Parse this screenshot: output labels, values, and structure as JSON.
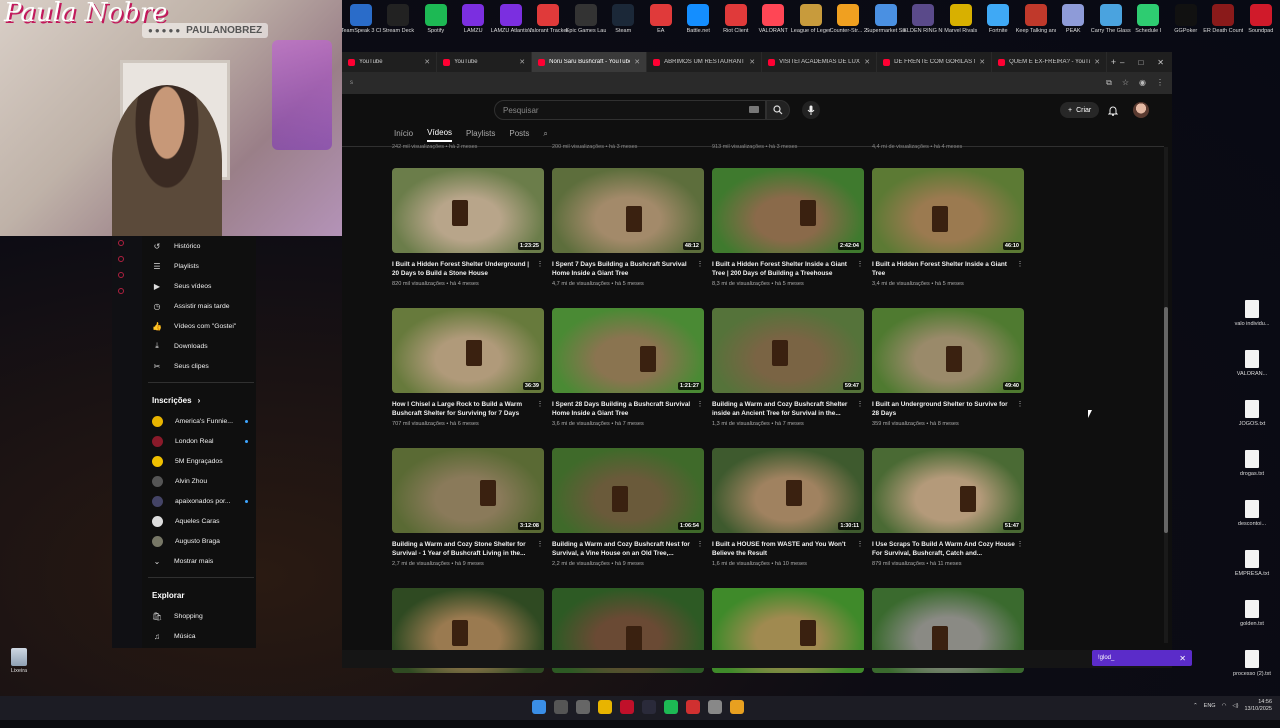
{
  "webcam": {
    "logo": "Paula Nobre",
    "handle": "PAULANOBREZ"
  },
  "desktop_top_icons": [
    {
      "label": "TeamSpeak 3 Client",
      "color": "#2a6cc9"
    },
    {
      "label": "Stream Deck",
      "color": "#222"
    },
    {
      "label": "Spotify",
      "color": "#1db954"
    },
    {
      "label": "LAMZU",
      "color": "#7b2fe0"
    },
    {
      "label": "LAMZU Atlantis P...",
      "color": "#7b2fe0"
    },
    {
      "label": "Valorant Tracker",
      "color": "#e03a3a"
    },
    {
      "label": "Epic Games Launcher",
      "color": "#333"
    },
    {
      "label": "Steam",
      "color": "#1b2838"
    },
    {
      "label": "EA",
      "color": "#e03a3a"
    },
    {
      "label": "Battle.net",
      "color": "#148eff"
    },
    {
      "label": "Riot Client",
      "color": "#e03a3a"
    },
    {
      "label": "VALORANT",
      "color": "#ff4655"
    },
    {
      "label": "League of Legends",
      "color": "#c89b3c"
    },
    {
      "label": "Counter-Str... 2",
      "color": "#f0a020"
    },
    {
      "label": "Supermarket Simulator",
      "color": "#4a90e2"
    },
    {
      "label": "ELDEN RING NIGHTREIGN",
      "color": "#5a4a8a"
    },
    {
      "label": "Marvel Rivals",
      "color": "#d8b000"
    },
    {
      "label": "Fortnite",
      "color": "#3fa9f5"
    },
    {
      "label": "Keep Talking and Nobo...",
      "color": "#c0392b"
    },
    {
      "label": "PEAK",
      "color": "#8e9bd8"
    },
    {
      "label": "Carry The Glass",
      "color": "#4aa3df"
    },
    {
      "label": "Schedule I",
      "color": "#2ecc71"
    },
    {
      "label": "GGPoker",
      "color": "#111"
    },
    {
      "label": "ER Death Counter",
      "color": "#8a1a1a"
    },
    {
      "label": "Soundpad",
      "color": "#d01a2a"
    }
  ],
  "desktop_right_icons": [
    "valo individu...",
    "VALORAN...",
    "JOGOS.txt",
    "drogas.txt",
    "descontoi...",
    "EMPRESA.txt",
    "golden.txt",
    "processo (2).txt"
  ],
  "recycle_bin": "Lixeira",
  "browser": {
    "tabs": [
      {
        "title": "YouTube",
        "active": false
      },
      {
        "title": "YouTube",
        "active": false
      },
      {
        "title": "Noru Saru Bushcraft - YouTube",
        "active": true
      },
      {
        "title": "ABRIMOS UM RESTAURANTE",
        "active": false
      },
      {
        "title": "VISITEI ACADEMIAS DE LUXO",
        "active": false
      },
      {
        "title": "DE FRENTE COM GORILAS N",
        "active": false
      },
      {
        "title": "QUEM É EX-FREIRA? - YouTu",
        "active": false
      }
    ],
    "url": "s"
  },
  "youtube": {
    "search_placeholder": "Pesquisar",
    "create_label": "Criar",
    "channel_tabs": [
      "Início",
      "Vídeos",
      "Playlists",
      "Posts"
    ],
    "active_tab": "Vídeos",
    "cut_meta": [
      "242 mil visualizações • há 2 meses",
      "200 mil visualizações • há 3 meses",
      "913 mil visualizações • há 3 meses",
      "4,4 mi de visualizações • há 4 meses"
    ],
    "videos": [
      {
        "title": "I Built a Hidden Forest Shelter Underground | 20 Days to Build a Stone House",
        "duration": "1:23:25",
        "meta": "820 mil visualizações • há 4 meses",
        "palette": [
          "#6b7d4a",
          "#b8a58a"
        ]
      },
      {
        "title": "I Spent 7 Days Building a Bushcraft Survival Home Inside a Giant Tree",
        "duration": "48:12",
        "meta": "4,7 mi de visualizações • há 5 meses",
        "palette": [
          "#5d6e3c",
          "#a38a6a"
        ]
      },
      {
        "title": "I Built a Hidden Forest Shelter Inside a Giant Tree | 200 Days of Building a Treehouse",
        "duration": "2:42:04",
        "meta": "8,3 mi de visualizações • há 5 meses",
        "palette": [
          "#3f7a2e",
          "#8a6a4a"
        ]
      },
      {
        "title": "I Built a Hidden Forest Shelter Inside a Giant Tree",
        "duration": "46:10",
        "meta": "3,4 mi de visualizações • há 5 meses",
        "palette": [
          "#5c7a34",
          "#9b7a50"
        ]
      },
      {
        "title": "How I Chisel a Large Rock to Build a Warm Bushcraft Shelter for Surviving for 7 Days",
        "duration": "36:39",
        "meta": "707 mil visualizações • há 6 meses",
        "palette": [
          "#677a3c",
          "#b09a7a"
        ]
      },
      {
        "title": "I Spent 28 Days Building a Bushcraft Survival Home Inside a Giant Tree",
        "duration": "1:21:27",
        "meta": "3,6 mi de visualizações • há 7 meses",
        "palette": [
          "#4a8a34",
          "#8a7450"
        ]
      },
      {
        "title": "Building a Warm and Cozy Bushcraft Shelter inside an Ancient Tree for Survival in the...",
        "duration": "59:47",
        "meta": "1,3 mi de visualizações • há 7 meses",
        "palette": [
          "#55733a",
          "#7a6444"
        ]
      },
      {
        "title": "I Built an Underground Shelter to Survive for 28 Days",
        "duration": "49:40",
        "meta": "359 mil visualizações • há 8 meses",
        "palette": [
          "#4f7a30",
          "#9a8a6a"
        ]
      },
      {
        "title": "Building a Warm and Cozy Stone Shelter for Survival - 1 Year of Bushcraft Living in the...",
        "duration": "3:12:08",
        "meta": "2,7 mi de visualizações • há 9 meses",
        "palette": [
          "#5a6a34",
          "#8a7a5a"
        ]
      },
      {
        "title": "Building a Warm and Cozy Bushcraft Nest for Survival, a Vine House on an Old Tree,...",
        "duration": "1:06:54",
        "meta": "2,2 mi de visualizações • há 9 meses",
        "palette": [
          "#3f6a2a",
          "#6a5a3a"
        ]
      },
      {
        "title": "I Built a HOUSE from WASTE and You Won't Believe the Result",
        "duration": "1:30:11",
        "meta": "1,6 mi de visualizações • há 10 meses",
        "palette": [
          "#3e5a2e",
          "#a08260"
        ]
      },
      {
        "title": "I Use Scraps To Build A Warm And Cozy House For Survival, Bushcraft, Catch and...",
        "duration": "51:47",
        "meta": "879 mil visualizações • há 11 meses",
        "palette": [
          "#4a6a34",
          "#b49a7a"
        ]
      },
      {
        "title": "",
        "duration": "",
        "meta": "",
        "palette": [
          "#2f4a22",
          "#9a7a50"
        ]
      },
      {
        "title": "",
        "duration": "",
        "meta": "",
        "palette": [
          "#2d5a24",
          "#6a4a34"
        ]
      },
      {
        "title": "",
        "duration": "",
        "meta": "",
        "palette": [
          "#3f8a2a",
          "#a08a50"
        ]
      },
      {
        "title": "",
        "duration": "",
        "meta": "",
        "palette": [
          "#3a6a2e",
          "#8a8a84"
        ]
      }
    ]
  },
  "sidebar": {
    "items": [
      {
        "icon": "history-icon",
        "glyph": "↺",
        "label": "Histórico"
      },
      {
        "icon": "playlists-icon",
        "glyph": "☰",
        "label": "Playlists"
      },
      {
        "icon": "your-videos-icon",
        "glyph": "▶",
        "label": "Seus vídeos"
      },
      {
        "icon": "watch-later-icon",
        "glyph": "◷",
        "label": "Assistir mais tarde"
      },
      {
        "icon": "liked-icon",
        "glyph": "👍",
        "label": "Vídeos com \"Gostei\""
      },
      {
        "icon": "downloads-icon",
        "glyph": "⤓",
        "label": "Downloads"
      },
      {
        "icon": "clips-icon",
        "glyph": "✂",
        "label": "Seus clipes"
      }
    ],
    "subscriptions_title": "Inscrições",
    "subscriptions": [
      {
        "name": "America's Funnie...",
        "color": "#e8b400",
        "new": true
      },
      {
        "name": "London Real",
        "color": "#8a1a2a",
        "new": true
      },
      {
        "name": "5M Engraçados",
        "color": "#f0c000",
        "new": false
      },
      {
        "name": "Alvin Zhou",
        "color": "#555",
        "new": false
      },
      {
        "name": "apaixonados por...",
        "color": "#446",
        "new": true
      },
      {
        "name": "Aqueles Caras",
        "color": "#ddd",
        "new": false
      },
      {
        "name": "Augusto Braga",
        "color": "#776",
        "new": false
      }
    ],
    "show_more": "Mostrar mais",
    "explore_title": "Explorar",
    "explore": [
      {
        "icon": "shopping-icon",
        "glyph": "🛍",
        "label": "Shopping"
      },
      {
        "icon": "music-icon",
        "glyph": "♫",
        "label": "Música"
      }
    ]
  },
  "overlay_chip": "!glod_",
  "taskbar": {
    "lang": "ENG",
    "time": "14:56",
    "date": "13/10/2025"
  }
}
